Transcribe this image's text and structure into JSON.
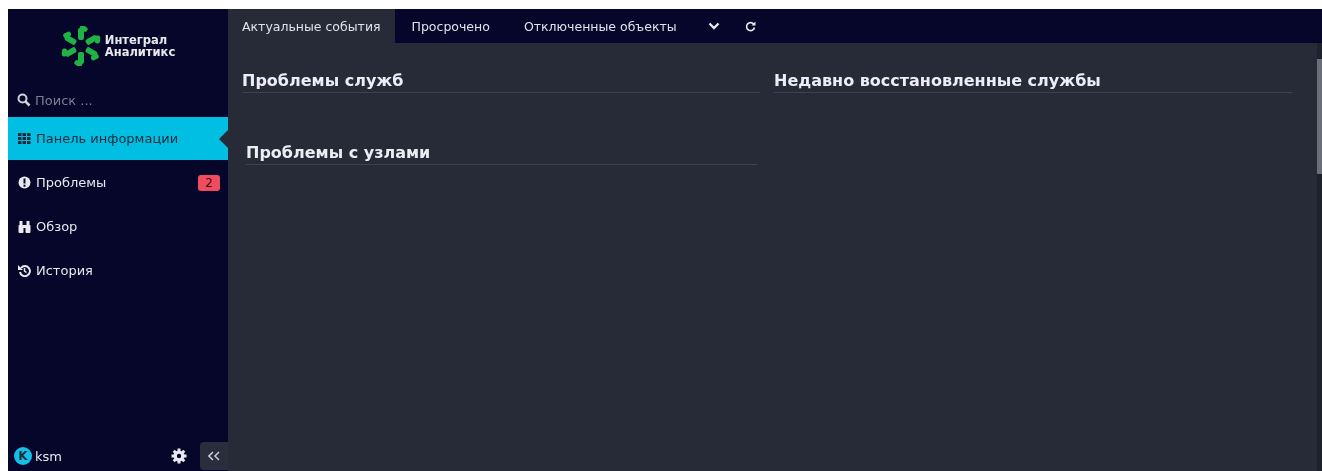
{
  "brand": {
    "line1": "Интеграл",
    "line2": "Аналитикс"
  },
  "search": {
    "placeholder": "Поиск ..."
  },
  "nav": [
    {
      "label": "Панель информации",
      "kind": "grid",
      "selected": true
    },
    {
      "label": "Проблемы",
      "kind": "alert",
      "selected": false,
      "badge": "2"
    },
    {
      "label": "Обзор",
      "kind": "binoculars",
      "selected": false
    },
    {
      "label": "История",
      "kind": "history",
      "selected": false
    }
  ],
  "user": {
    "initial": "K",
    "name": "ksm"
  },
  "tabs": [
    {
      "label": "Актуальные события",
      "selected": true
    },
    {
      "label": "Просрочено",
      "selected": false
    },
    {
      "label": "Отключенные объекты",
      "selected": false
    }
  ],
  "columns": [
    {
      "sections": [
        "Проблемы служб",
        "Проблемы с узлами"
      ]
    },
    {
      "sections": [
        "Недавно восстановленные службы"
      ]
    }
  ]
}
